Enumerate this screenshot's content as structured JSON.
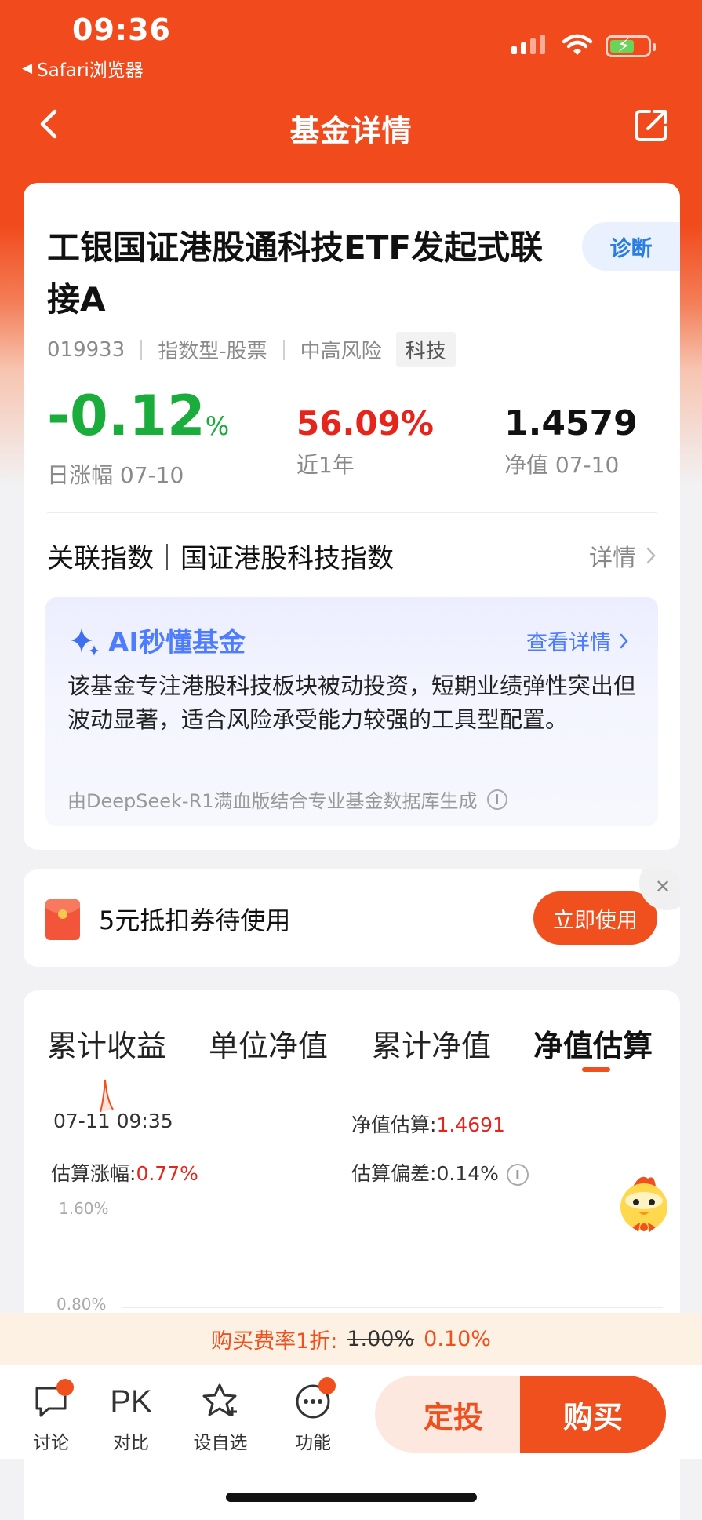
{
  "status_bar": {
    "time": "09:36",
    "back_app": "Safari浏览器"
  },
  "nav": {
    "title": "基金详情"
  },
  "fund": {
    "name": "工银国证港股通科技ETF发起式联接A",
    "diagnose_label": "诊断",
    "code": "019933",
    "type": "指数型-股票",
    "risk": "中高风险",
    "tag": "科技",
    "day_change": "-0.12",
    "day_change_unit": "%",
    "day_change_label": "日涨幅 07-10",
    "year_return": "56.09%",
    "year_return_label": "近1年",
    "nav_value": "1.4579",
    "nav_label": "净值 07-10",
    "index_label": "关联指数｜国证港股科技指数",
    "index_more": "详情"
  },
  "ai": {
    "title": "AI秒懂基金",
    "more": "查看详情",
    "text": "该基金专注港股科技板块被动投资，短期业绩弹性突出但波动显著，适合风险承受能力较强的工具型配置。",
    "footer": "由DeepSeek-R1满血版结合专业基金数据库生成"
  },
  "coupon": {
    "text": "5元抵扣券待使用",
    "button": "立即使用"
  },
  "tabs": [
    {
      "label": "累计收益"
    },
    {
      "label": "单位净值"
    },
    {
      "label": "累计净值"
    },
    {
      "label": "净值估算"
    }
  ],
  "estimate": {
    "time": "07-11 09:35",
    "nav_label": "净值估算:",
    "nav_value": "1.4691",
    "change_label": "估算涨幅:",
    "change_value": "0.77%",
    "deviation_label": "估算偏差:",
    "deviation_value": "0.14%",
    "y_ticks": [
      "1.60%",
      "0.80%"
    ]
  },
  "fee": {
    "prefix": "购买费率1折:",
    "original": "1.00%",
    "discounted": "0.10%"
  },
  "bottom": {
    "tools": [
      {
        "label": "讨论"
      },
      {
        "label": "对比",
        "icon_text": "PK"
      },
      {
        "label": "设自选"
      },
      {
        "label": "功能"
      }
    ],
    "dingtou": "定投",
    "buy": "购买"
  },
  "colors": {
    "brand": "#f0501e",
    "up": "#e5251b",
    "down": "#1aad3c",
    "ai": "#4d7cff"
  }
}
